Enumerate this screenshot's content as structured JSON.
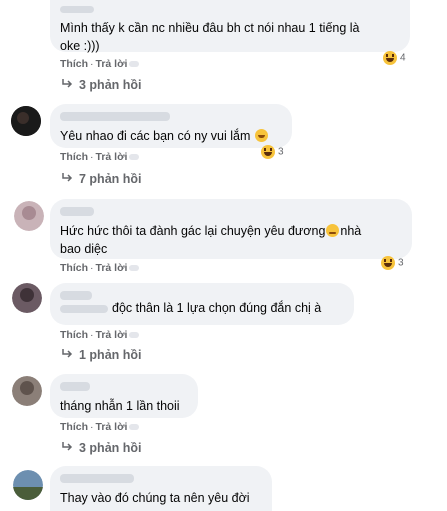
{
  "comments": [
    {
      "text_lines": [
        "Mình thấy k cần nc nhiều đâu bh ct nói nhau 1 tiếng là",
        "oke :)))"
      ],
      "like": "Thích",
      "reply": "Trả lời",
      "reaction_count": "4",
      "replies": "3 phản hồi"
    },
    {
      "text_lines": [
        "Yêu nhao đi các bạn có ny vui lắm"
      ],
      "like": "Thích",
      "reply": "Trả lời",
      "reaction_count": "3",
      "replies": "7 phản hồi"
    },
    {
      "text_lines": [
        "Hức hức thôi ta đành gác lại chuyện yêu đương",
        "bao diệc"
      ],
      "line1_suffix": "nhà",
      "like": "Thích",
      "reply": "Trả lời",
      "reaction_count": "3",
      "replies": ""
    },
    {
      "text_lines": [
        "độc thân là 1 lựa chọn đúng đắn chị à"
      ],
      "like": "Thích",
      "reply": "Trả lời",
      "reaction_count": "",
      "replies": "1 phản hồi"
    },
    {
      "text_lines": [
        "tháng nhẫn 1 lần thoii"
      ],
      "like": "Thích",
      "reply": "Trả lời",
      "reaction_count": "",
      "replies": "3 phản hồi"
    },
    {
      "text_lines": [
        "Thay vào đó chúng ta nên yêu đời"
      ],
      "like": "",
      "reply": "",
      "reaction_count": "",
      "replies": ""
    }
  ],
  "colors": {
    "bubble": "#f0f2f5",
    "muted_text": "#65676b",
    "reaction": "#f7c33b"
  },
  "icons": {
    "reply_arrow": "reply-arrow-icon",
    "reaction": "haha-reaction-icon"
  }
}
